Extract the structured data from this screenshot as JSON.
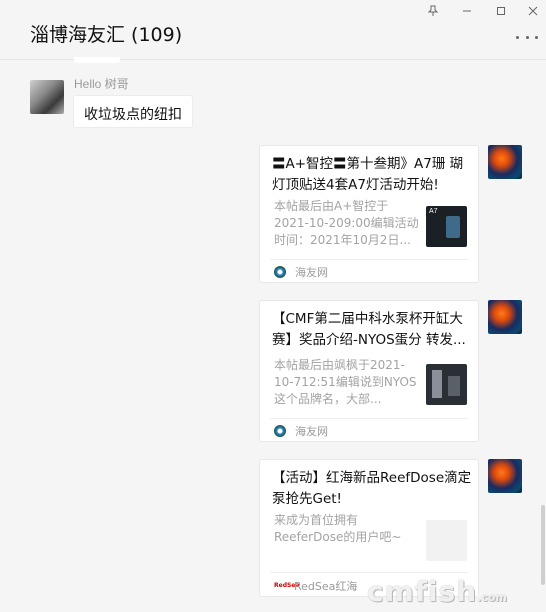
{
  "window": {
    "title": "淄博海友汇 (109)",
    "controls": {
      "pin": "pin-icon",
      "minimize": "minimize-icon",
      "maximize": "maximize-icon",
      "close": "close-icon"
    },
    "more": "more-icon"
  },
  "messages": {
    "left": {
      "sender": "Hello  树哥",
      "text": "收垃圾点的纽扣"
    },
    "cards": [
      {
        "title": "〓A+智控〓第十叁期》A7珊 瑚灯顶贴送4套A7灯活动开始!",
        "desc": "本帖最后由A+智控于2021-10-209:00编辑活动时间：2021年10月2日...",
        "source": "海友网",
        "thumb_label": "A7",
        "thumb_color": "#1b1f26"
      },
      {
        "title": "【CMF第二届中科水泵杯开缸大赛】奖品介绍-NYOS蛋分 转发...",
        "desc": "本帖最后由飒枫于2021-10-712:51编辑说到NYOS这个品牌名，大部...",
        "source": "海友网",
        "thumb_label": "",
        "thumb_color": "#2a2f35"
      },
      {
        "title": "【活动】红海新品ReefDose滴定泵抢先Get!",
        "desc": "来成为首位拥有ReeferDose的用户吧~",
        "source": "RedSea红海",
        "source_badge": "RedSea",
        "thumb_label": "",
        "thumb_color": "#f2f2f2"
      }
    ]
  },
  "watermark": {
    "main": "cmfish",
    "suffix": ".com"
  }
}
